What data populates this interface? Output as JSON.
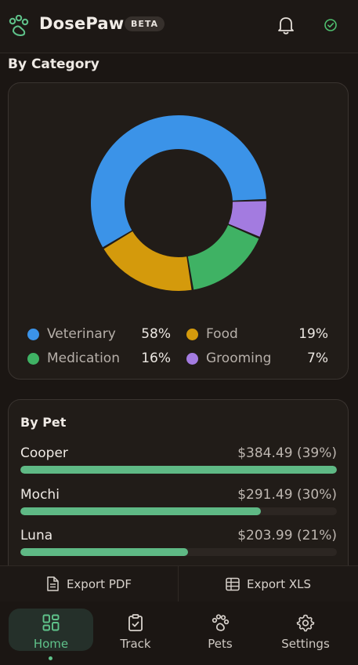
{
  "header": {
    "app_title": "DosePaw",
    "badge": "BETA",
    "icons": [
      "paw-logo-icon",
      "bell-icon",
      "check-circle-icon"
    ]
  },
  "category_section": {
    "title": "By Category",
    "chart_data": {
      "type": "pie",
      "categories": [
        "Veterinary",
        "Food",
        "Medication",
        "Grooming"
      ],
      "values": [
        58,
        19,
        16,
        7
      ],
      "colors": [
        "#3b93e8",
        "#d49a0c",
        "#3fb264",
        "#a37be0"
      ],
      "legend": [
        {
          "label": "Veterinary",
          "pct": "58%",
          "color": "#3b93e8"
        },
        {
          "label": "Food",
          "pct": "19%",
          "color": "#d49a0c"
        },
        {
          "label": "Medication",
          "pct": "16%",
          "color": "#3fb264"
        },
        {
          "label": "Grooming",
          "pct": "7%",
          "color": "#a37be0"
        }
      ]
    }
  },
  "pet_section": {
    "title": "By Pet",
    "pets": [
      {
        "name": "Cooper",
        "amount": "$384.49 (39%)",
        "fraction": 1.0
      },
      {
        "name": "Mochi",
        "amount": "$291.49 (30%)",
        "fraction": 0.76
      },
      {
        "name": "Luna",
        "amount": "$203.99 (21%)",
        "fraction": 0.53
      }
    ]
  },
  "export": {
    "pdf_label": "Export PDF",
    "xls_label": "Export XLS"
  },
  "nav": {
    "home": "Home",
    "track": "Track",
    "pets": "Pets",
    "settings": "Settings"
  },
  "colors": {
    "accent": "#5fc28a",
    "bar": "#5fb985"
  }
}
